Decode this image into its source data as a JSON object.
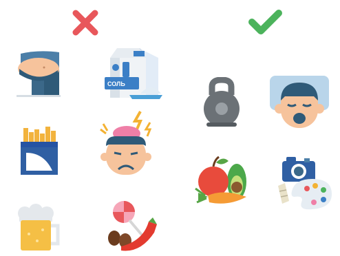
{
  "columns": {
    "avoid": {
      "marker_icon": "cross-icon",
      "marker_color": "#e8575b",
      "items": [
        "belly-icon",
        "milk-and-salt-icon",
        "cigarettes-icon",
        "stressed-head-icon",
        "beer-icon",
        "candy-coffee-chili-icon"
      ]
    },
    "recommended": {
      "marker_icon": "checkmark-icon",
      "marker_color": "#4cb35c",
      "items": [
        "kettlebell-icon",
        "sleeping-person-icon",
        "fruits-vegetables-icon",
        "camera-and-palette-icon"
      ]
    }
  },
  "package_text": "СОЛЬ"
}
